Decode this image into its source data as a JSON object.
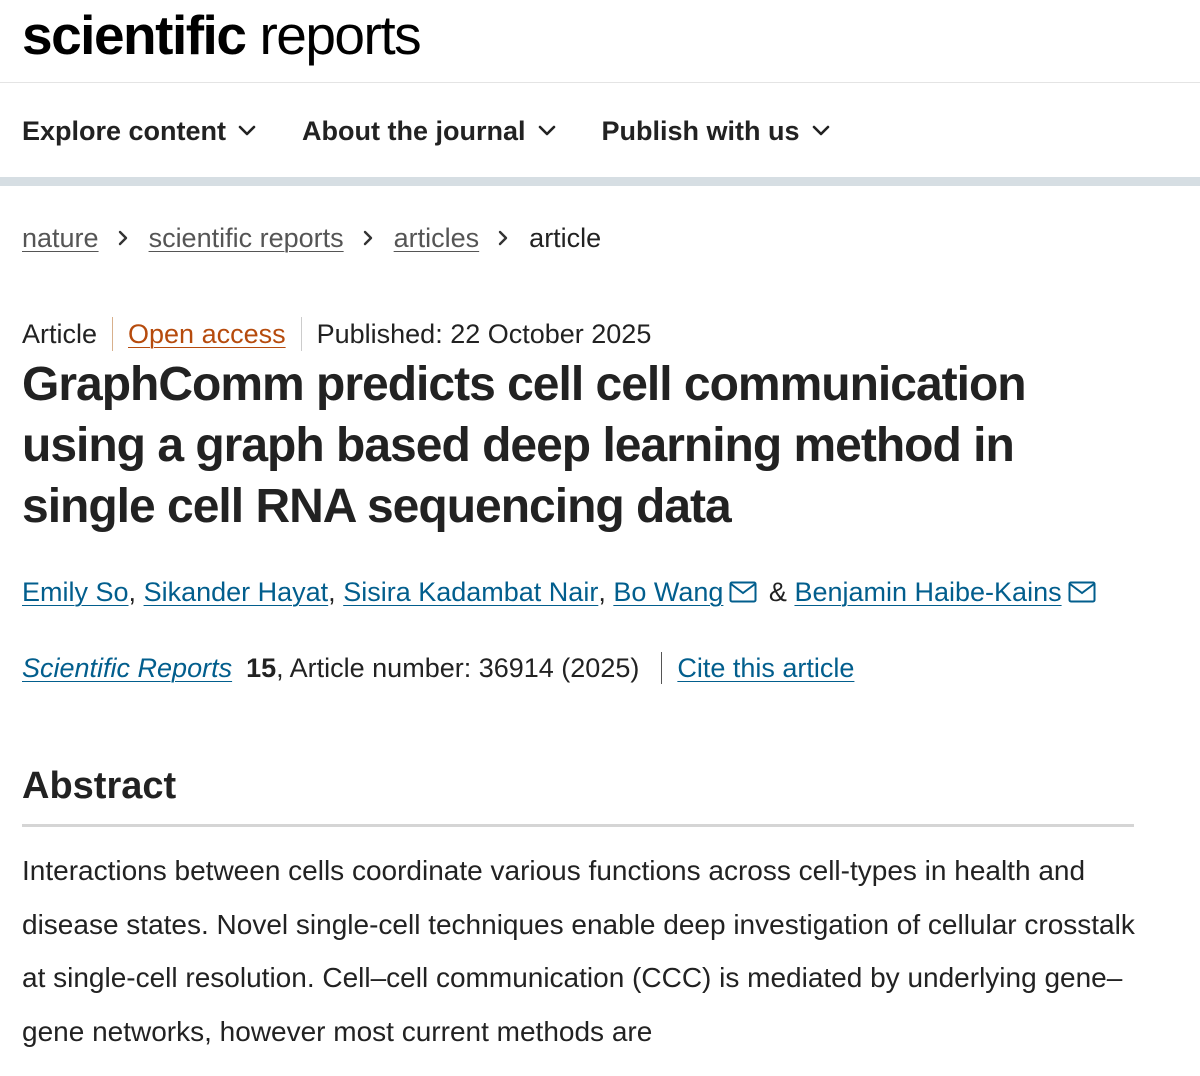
{
  "brand": {
    "bold": "scientific",
    "light": "reports"
  },
  "nav": {
    "items": [
      {
        "label": "Explore content",
        "icon": "chevron-down-icon"
      },
      {
        "label": "About the journal",
        "icon": "chevron-down-icon"
      },
      {
        "label": "Publish with us",
        "icon": "chevron-down-icon"
      }
    ]
  },
  "breadcrumb": {
    "items": [
      "nature",
      "scientific reports",
      "articles"
    ],
    "current": "article"
  },
  "article": {
    "type": "Article",
    "access": "Open access",
    "published": "Published: 22 October 2025",
    "title": "GraphComm predicts cell cell communication using a graph based deep learning method in single cell RNA sequencing data",
    "authors": [
      "Emily So",
      "Sikander Hayat",
      "Sisira Kadambat Nair",
      "Bo Wang",
      "Benjamin Haibe-Kains"
    ],
    "author_sep": ",",
    "author_amp": "&",
    "journal": "Scientific Reports",
    "volume": "15",
    "article_number": ", Article number: 36914 (2025)",
    "cite": "Cite this article"
  },
  "abstract": {
    "heading": "Abstract",
    "text": "Interactions between cells coordinate various functions across cell-types in health and disease states. Novel single-cell techniques enable deep investigation of cellular crosstalk at single-cell resolution. Cell–cell communication (CCC) is mediated by underlying gene–gene networks, however most current methods are"
  },
  "colors": {
    "link": "#025e8d",
    "open_access": "#b64b0d",
    "nav_bar": "#d6dee3"
  }
}
